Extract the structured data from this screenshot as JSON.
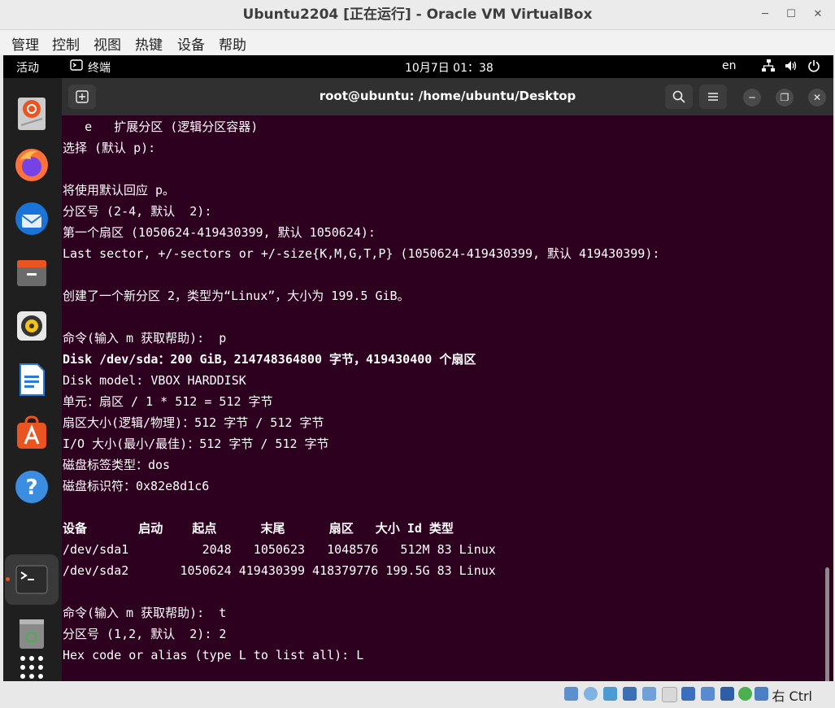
{
  "window": {
    "title": "Ubuntu2204 [正在运行] - Oracle VM VirtualBox",
    "menu": [
      "管理",
      "控制",
      "视图",
      "热键",
      "设备",
      "帮助"
    ]
  },
  "gnome_bar": {
    "activities": "活动",
    "app_name": "终端",
    "clock": "10月7日  01：38",
    "lang": "en"
  },
  "terminal": {
    "title": "root@ubuntu: /home/ubuntu/Desktop",
    "lines": [
      "   e   扩展分区 (逻辑分区容器)",
      "选择 (默认 p):",
      "",
      "将使用默认回应 p。",
      "分区号 (2-4, 默认  2):",
      "第一个扇区 (1050624-419430399, 默认 1050624):",
      "Last sector, +/-sectors or +/-size{K,M,G,T,P} (1050624-419430399, 默认 419430399):",
      "",
      "创建了一个新分区 2，类型为“Linux”，大小为 199.5 GiB。",
      "",
      "命令(输入 m 获取帮助):  p",
      "Disk /dev/sda：200 GiB，214748364800 字节，419430400 个扇区",
      "Disk model: VBOX HARDDISK",
      "单元：扇区 / 1 * 512 = 512 字节",
      "扇区大小(逻辑/物理)：512 字节 / 512 字节",
      "I/O 大小(最小/最佳)：512 字节 / 512 字节",
      "磁盘标签类型：dos",
      "磁盘标识符：0x82e8d1c6",
      "",
      "设备       启动    起点      末尾      扇区   大小 Id 类型",
      "/dev/sda1          2048   1050623   1048576   512M 83 Linux",
      "/dev/sda2       1050624 419430399 418379776 199.5G 83 Linux",
      "",
      "命令(输入 m 获取帮助):  t",
      "分区号 (1,2, 默认  2): 2",
      "Hex code or alias (type L to list all): L"
    ],
    "bold_lines": [
      11,
      19
    ]
  },
  "statusbar": {
    "host_key": "右 Ctrl"
  },
  "colors": {
    "terminal_bg": "#2c001e",
    "accent": "#e95420"
  }
}
